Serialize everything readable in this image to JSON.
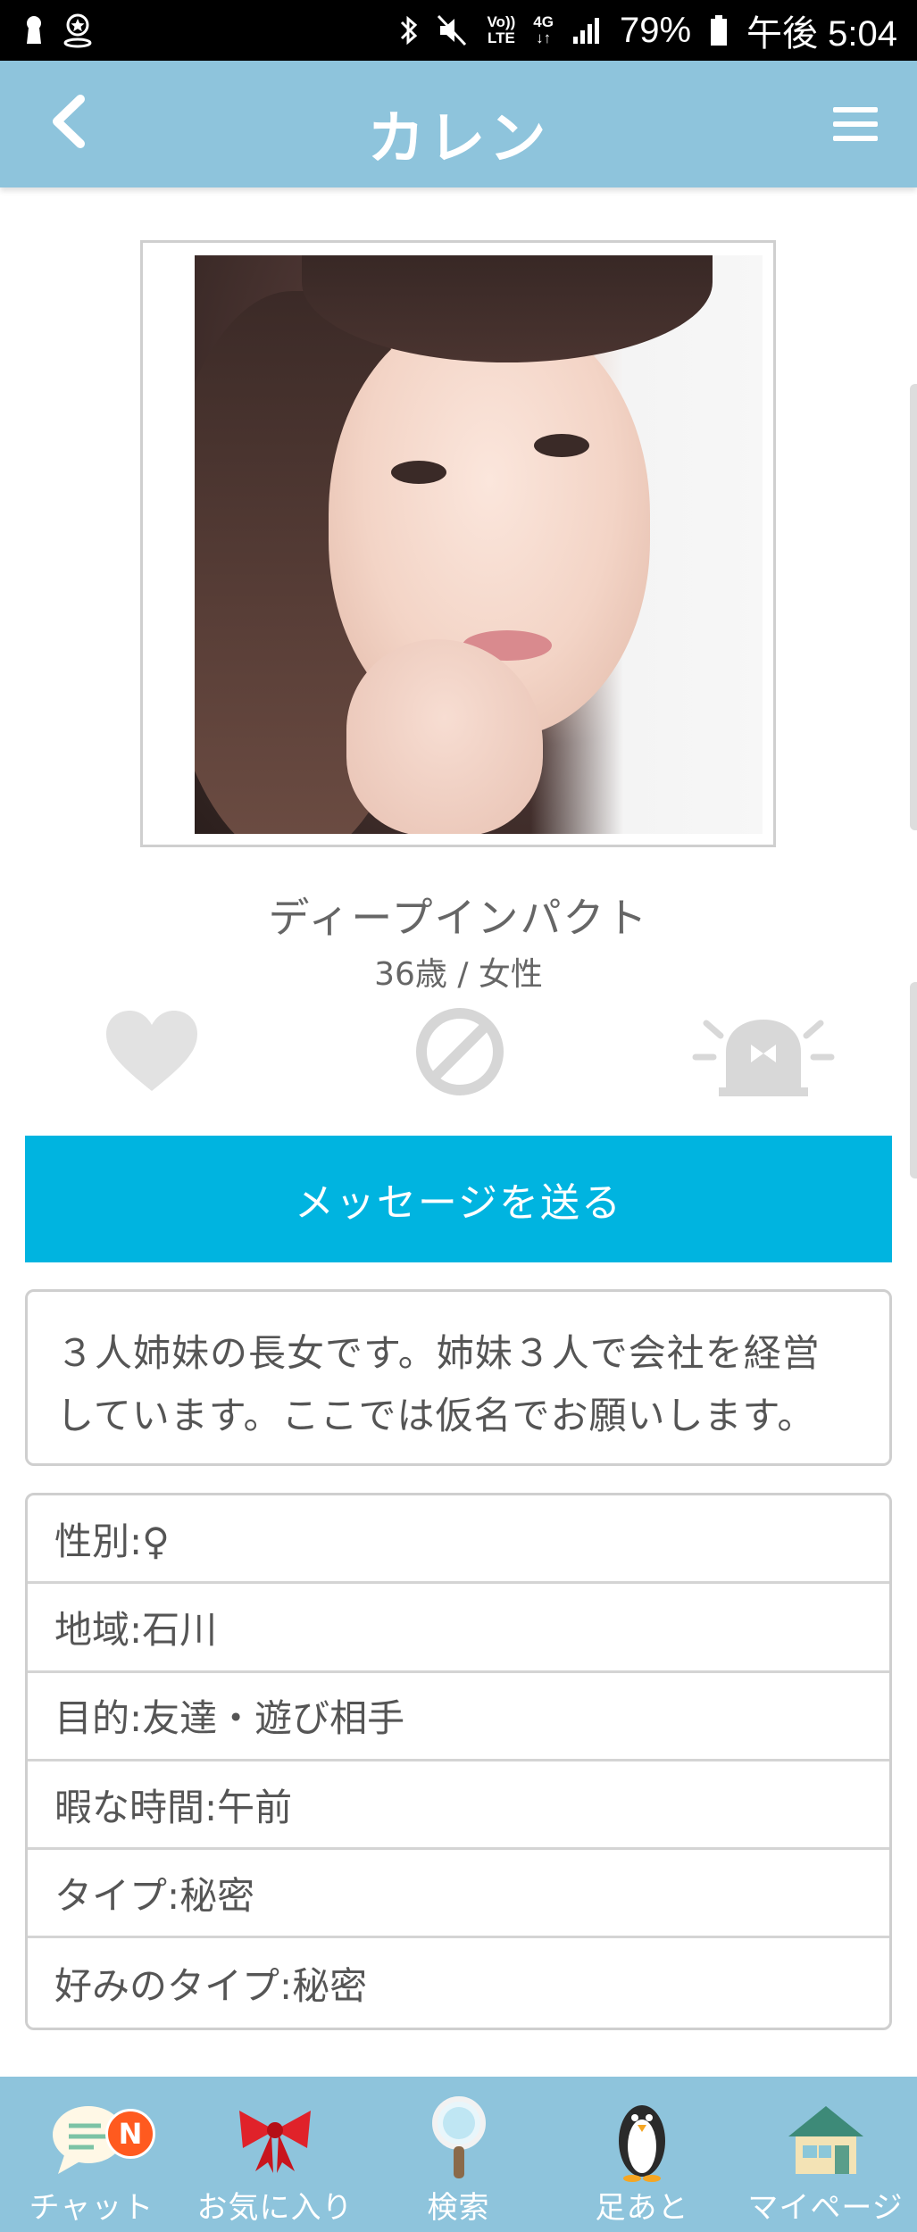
{
  "status_bar": {
    "battery": "79%",
    "time": "午後 5:04",
    "network_top": "Vo))",
    "network_bottom": "LTE",
    "signal_type": "4G"
  },
  "header": {
    "title": "カレン",
    "back_icon": "chevron-left-icon",
    "menu_icon": "hamburger-menu-icon",
    "background_color": "#8ec4dc"
  },
  "profile": {
    "nickname": "ディープインパクト",
    "age_gender": "36歳 / 女性",
    "introduction_line1": "３人姉妹の長女です。姉妹３人で会社を経営",
    "introduction_line2": "しています。ここでは仮名でお願いします。"
  },
  "actions": {
    "like_icon": "heart-icon",
    "block_icon": "block-icon",
    "report_icon": "alarm-siren-icon"
  },
  "message_button": {
    "label": "メッセージを送る",
    "color": "#00b4e0"
  },
  "details": [
    {
      "label": "性別:♀"
    },
    {
      "label": "地域:石川"
    },
    {
      "label": "目的:友達・遊び相手"
    },
    {
      "label": "暇な時間:午前"
    },
    {
      "label": "タイプ:秘密"
    },
    {
      "label": "好みのタイプ:秘密"
    }
  ],
  "bottom_nav": [
    {
      "label": "チャット",
      "icon": "chat-bubble-icon",
      "badge": "N"
    },
    {
      "label": "お気に入り",
      "icon": "ribbon-bow-icon"
    },
    {
      "label": "検索",
      "icon": "magnifier-icon"
    },
    {
      "label": "足あと",
      "icon": "penguin-icon"
    },
    {
      "label": "マイページ",
      "icon": "house-icon"
    }
  ]
}
